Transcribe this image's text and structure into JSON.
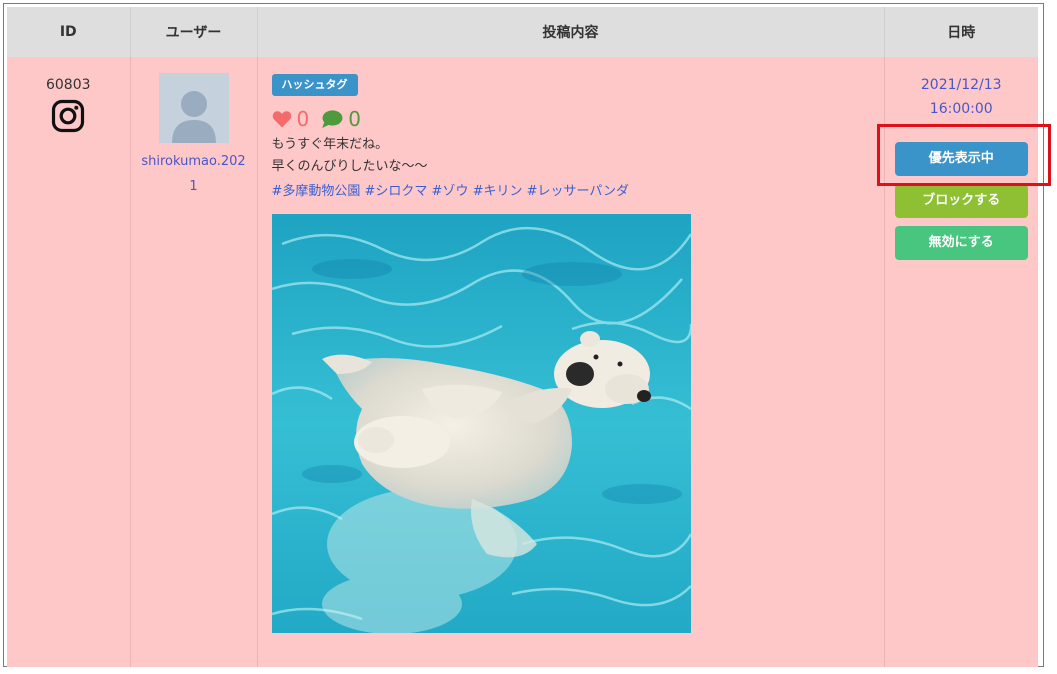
{
  "table": {
    "headers": [
      "ID",
      "ユーザー",
      "投稿内容",
      "日時"
    ]
  },
  "row": {
    "id": "60803",
    "platform_icon": "instagram-icon",
    "user": {
      "avatar_icon": "default-user-avatar",
      "username": "shirokumao.2021"
    },
    "post": {
      "badge": "ハッシュタグ",
      "likes": "0",
      "comments": "0",
      "text_lines": [
        "もうすぐ年末だね。",
        "早くのんびりしたいな〜〜"
      ],
      "hashtags": "#多摩動物公園 #シロクマ #ゾウ #キリン #レッサーパンダ",
      "image": "photo of a polar bear swimming on its back in turquoise water"
    },
    "date": "2021/12/13",
    "time": "16:00:00",
    "actions": {
      "priority": "優先表示中",
      "block": "ブロックする",
      "disable": "無効にする"
    }
  },
  "colors": {
    "row_background": "#ffc8c8",
    "header_background": "#dedede",
    "link": "#4a56c8",
    "badge": "#3a93c9",
    "priority_button": "#3a93c9",
    "block_button": "#8fbf33",
    "disable_button": "#48c57f",
    "like": "#f36b6b",
    "comment": "#4e9a3c",
    "highlight": "#e0101a"
  }
}
